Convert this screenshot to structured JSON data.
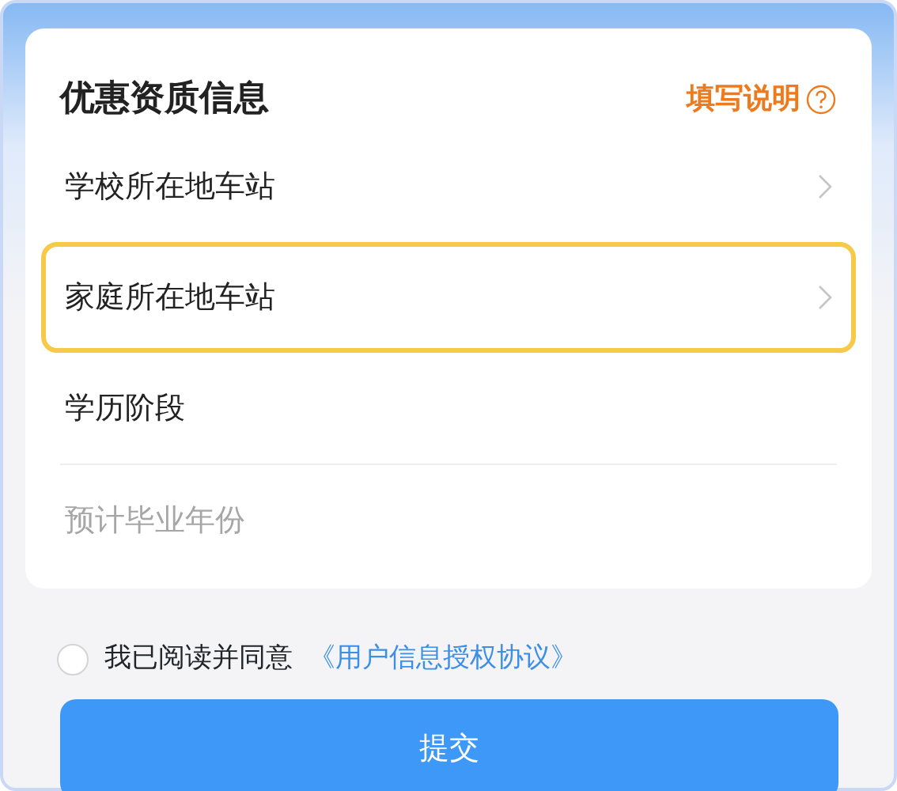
{
  "card": {
    "title": "优惠资质信息",
    "help_link": "填写说明",
    "rows": [
      {
        "kind": "select",
        "label": "学校所在地车站",
        "highlighted": false
      },
      {
        "kind": "select",
        "label": "家庭所在地车站",
        "highlighted": true
      },
      {
        "kind": "plain",
        "label": "学历阶段",
        "highlighted": false
      },
      {
        "kind": "placeholder",
        "label": "预计毕业年份",
        "highlighted": false
      }
    ]
  },
  "agreement": {
    "checked": false,
    "text": "我已阅读并同意",
    "link": "《用户信息授权协议》"
  },
  "submit_button": "提交"
}
